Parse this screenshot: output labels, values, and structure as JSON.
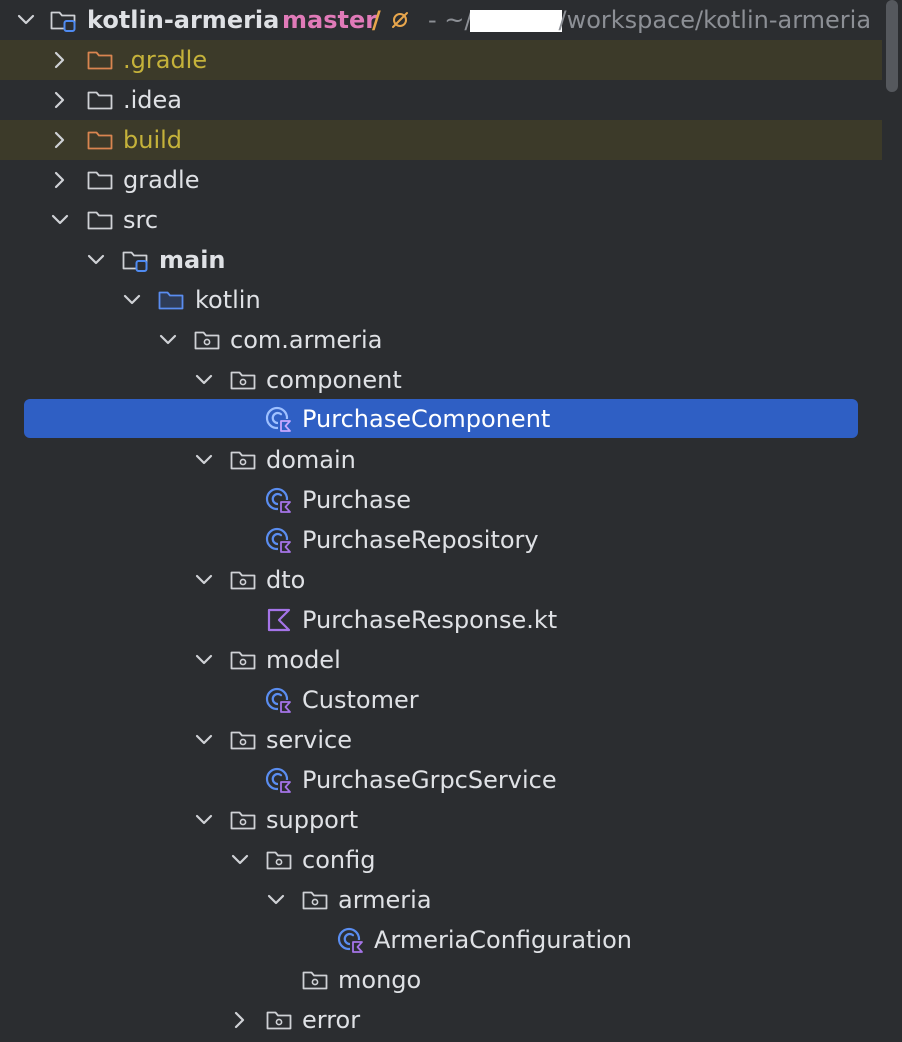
{
  "root": {
    "name": "kotlin-armeria",
    "branch": "master",
    "branch_separator": "/",
    "sync_icon": "no-vcs-icon",
    "path_prefix": "- ~/",
    "path_suffix": "/workspace/kotlin-armeria"
  },
  "tree": [
    {
      "label": ".gradle",
      "icon": "folder-excluded-icon",
      "expanded": false,
      "excluded": true
    },
    {
      "label": ".idea",
      "icon": "folder-icon",
      "expanded": false
    },
    {
      "label": "build",
      "icon": "folder-excluded-icon",
      "expanded": false,
      "excluded": true
    },
    {
      "label": "gradle",
      "icon": "folder-icon",
      "expanded": false
    },
    {
      "label": "src",
      "icon": "folder-icon",
      "expanded": true
    },
    {
      "label": "main",
      "icon": "module-folder-icon",
      "expanded": true
    },
    {
      "label": "kotlin",
      "icon": "source-root-icon",
      "expanded": true
    },
    {
      "label": "com.armeria",
      "icon": "package-icon",
      "expanded": true
    },
    {
      "label": "component",
      "icon": "package-icon",
      "expanded": true
    },
    {
      "label": "PurchaseComponent",
      "icon": "kotlin-class-icon",
      "selected": true
    },
    {
      "label": "domain",
      "icon": "package-icon",
      "expanded": true
    },
    {
      "label": "Purchase",
      "icon": "kotlin-class-icon"
    },
    {
      "label": "PurchaseRepository",
      "icon": "kotlin-class-icon"
    },
    {
      "label": "dto",
      "icon": "package-icon",
      "expanded": true
    },
    {
      "label": "PurchaseResponse.kt",
      "icon": "kotlin-file-icon"
    },
    {
      "label": "model",
      "icon": "package-icon",
      "expanded": true
    },
    {
      "label": "Customer",
      "icon": "kotlin-class-icon"
    },
    {
      "label": "service",
      "icon": "package-icon",
      "expanded": true
    },
    {
      "label": "PurchaseGrpcService",
      "icon": "kotlin-class-icon"
    },
    {
      "label": "support",
      "icon": "package-icon",
      "expanded": true
    },
    {
      "label": "config",
      "icon": "package-icon",
      "expanded": true
    },
    {
      "label": "armeria",
      "icon": "package-icon",
      "expanded": true
    },
    {
      "label": "ArmeriaConfiguration",
      "icon": "kotlin-class-icon"
    },
    {
      "label": "mongo",
      "icon": "package-icon"
    },
    {
      "label": "error",
      "icon": "package-icon",
      "expanded": false
    }
  ],
  "colors": {
    "background": "#2b2d30",
    "selection": "#2f5fc4",
    "excluded_row": "#3c3a29",
    "excluded_text": "#c5b23a",
    "branch": "#e07ab8",
    "kotlin_accent": "#a574e8",
    "class_blue": "#5a8df0"
  }
}
